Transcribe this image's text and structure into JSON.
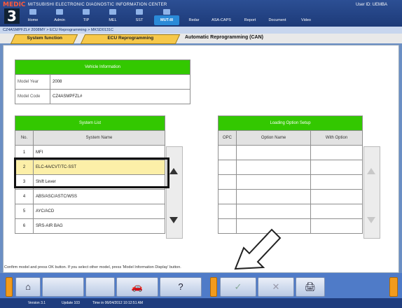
{
  "header": {
    "brand": "MEDIC",
    "brand_number": "3",
    "title": "MITSUBISHI ELECTRONIC DIAGNOSTIC INFORMATION CENTER",
    "user": "User ID: UEMBA",
    "nav": [
      {
        "label": "Home"
      },
      {
        "label": "Admin"
      },
      {
        "label": "TIP"
      },
      {
        "label": "MEL"
      },
      {
        "label": "SST"
      },
      {
        "label": "MUT-III"
      },
      {
        "label": "Redar"
      },
      {
        "label": "ASA-CAPS"
      },
      {
        "label": "Report"
      },
      {
        "label": "Document"
      },
      {
        "label": "Video"
      }
    ]
  },
  "breadcrumb": "CZ4ASMPFZL# 2008MY > ECU Reprogramming > MKSD0131C",
  "tabs": {
    "system_function": "System function",
    "ecu_reprogramming": "ECU Reprogramming",
    "title": "Automatic Reprogramming (CAN)"
  },
  "vehicle_info": {
    "heading": "Vehicle Information",
    "rows": [
      {
        "label": "Model Year",
        "value": "2008"
      },
      {
        "label": "Model Code",
        "value": "CZ4ASMPFZL#"
      }
    ]
  },
  "system_list": {
    "heading": "System List",
    "col_no": "No.",
    "col_name": "System Name",
    "rows": [
      {
        "no": "1",
        "name": "MFI"
      },
      {
        "no": "2",
        "name": "ELC-4A/CVT/TC-SST"
      },
      {
        "no": "3",
        "name": "Shift Lever"
      },
      {
        "no": "4",
        "name": "ABS/ASC/ASTC/WSS"
      },
      {
        "no": "5",
        "name": "AYC/ACD"
      },
      {
        "no": "6",
        "name": "SRS-AIR BAG"
      }
    ]
  },
  "loading_option": {
    "heading": "Loading Option Setup",
    "col_opc": "OPC",
    "col_option": "Option Name",
    "col_with": "With Option"
  },
  "status_message": "Confirm model and press OK button. If you select other model, press 'Model Information Display' button.",
  "toolbar": {
    "home": "⌂",
    "model_info": "🚗",
    "help": "?",
    "ok": "✓",
    "cancel": "✕",
    "print": "🖨"
  },
  "statusbar": {
    "version": "Version 3.1",
    "update": "Update 103",
    "time": "Time in 06/04/2012 10:12:51 AM"
  },
  "colors": {
    "header": "#2c4f94",
    "table_head": "#33c800",
    "tab": "#f6c84a",
    "selected_row": "#fcefa8"
  }
}
